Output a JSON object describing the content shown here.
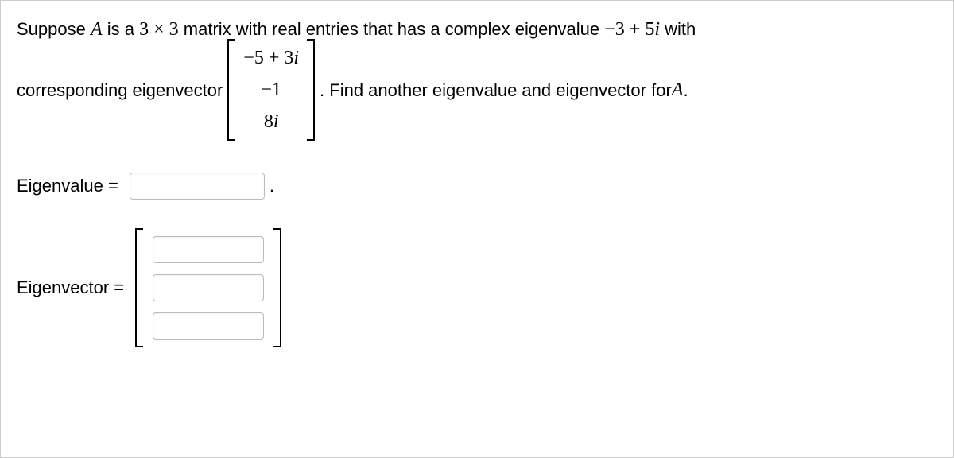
{
  "problem": {
    "line1_pre": "Suppose ",
    "line1_A": "A",
    "line1_mid1": " is a ",
    "line1_dim": "3 × 3",
    "line1_mid2": " matrix with real entries that has a complex eigenvalue ",
    "line1_eigval": "−3 + 5",
    "line1_i1": "i",
    "line1_post": " with",
    "line2_pre": "corresponding eigenvector ",
    "vector": {
      "e1a": "−5 + 3",
      "e1b": "i",
      "e2": "−1",
      "e3a": "8",
      "e3b": "i"
    },
    "line2_post_a": ". Find another eigenvalue and eigenvector for ",
    "line2_post_A": "A",
    "line2_post_end": "."
  },
  "answers": {
    "eigenvalue_label": "Eigenvalue =",
    "eigenvector_label": "Eigenvector =",
    "eigenvalue_value": "",
    "vec1": "",
    "vec2": "",
    "vec3": ""
  }
}
